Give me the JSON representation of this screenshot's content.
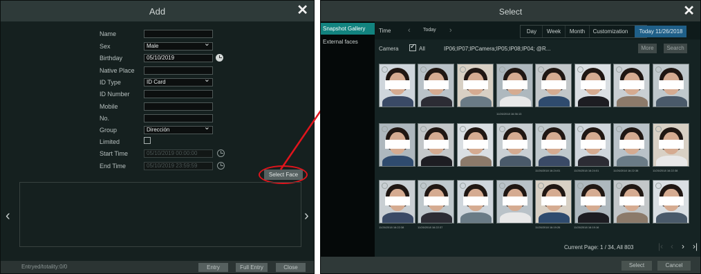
{
  "add_dialog": {
    "title": "Add",
    "labels": {
      "name": "Name",
      "sex": "Sex",
      "birthday": "Birthday",
      "native_place": "Native Place",
      "id_type": "ID Type",
      "id_number": "ID Number",
      "mobile": "Mobile",
      "no": "No.",
      "group": "Group",
      "limited": "Limited",
      "start_time": "Start Time",
      "end_time": "End Time"
    },
    "values": {
      "name": "",
      "sex": "Male",
      "birthday": "05/10/2019",
      "native_place": "",
      "id_type": "ID Card",
      "id_number": "",
      "mobile": "",
      "no": "",
      "group": "Dirección",
      "start_time": "05/10/2019 00:00:00",
      "end_time": "05/10/2019 23:59:59"
    },
    "select_face_label": "Select Face",
    "footer": {
      "status": "Entryed/totality:0/0",
      "entry_label": "Entry",
      "full_entry_label": "Full Entry",
      "close_label": "Close"
    }
  },
  "select_dialog": {
    "title": "Select",
    "sidebar": [
      "Snapshot Gallery",
      "External faces"
    ],
    "time_label": "Time",
    "today_label": "Today",
    "ranges": [
      "Day",
      "Week",
      "Month",
      "Customization",
      "Today 11/26/2018"
    ],
    "camera_label": "Camera",
    "all_label": "All",
    "camera_list": "IP06;IP07;IPCamera;IP05;IP08;IP04;  @R...",
    "more_label": "More",
    "search_label": "Search",
    "timestamps": {
      "row1_4": "11/26/2018 16:36:13",
      "row2_5": "11/26/2018 16:24:01",
      "row2_6": "11/26/2018 16:24:01",
      "row2_7": "11/26/2018 16:22:38",
      "row2_8": "11/26/2018 16:22:38",
      "row3_1": "11/26/2018 16:22:38",
      "row3_2": "11/26/2018 16:22:37",
      "row3_5": "11/26/2018 16:19:26",
      "row3_6": "11/26/2018 16:19:16"
    },
    "pager_text": "Current Page: 1 / 34, All 803",
    "select_label": "Select",
    "cancel_label": "Cancel"
  },
  "colors": {
    "accent": "#12837f",
    "annotation": "#e0141c",
    "active_range": "#1f5f88"
  }
}
